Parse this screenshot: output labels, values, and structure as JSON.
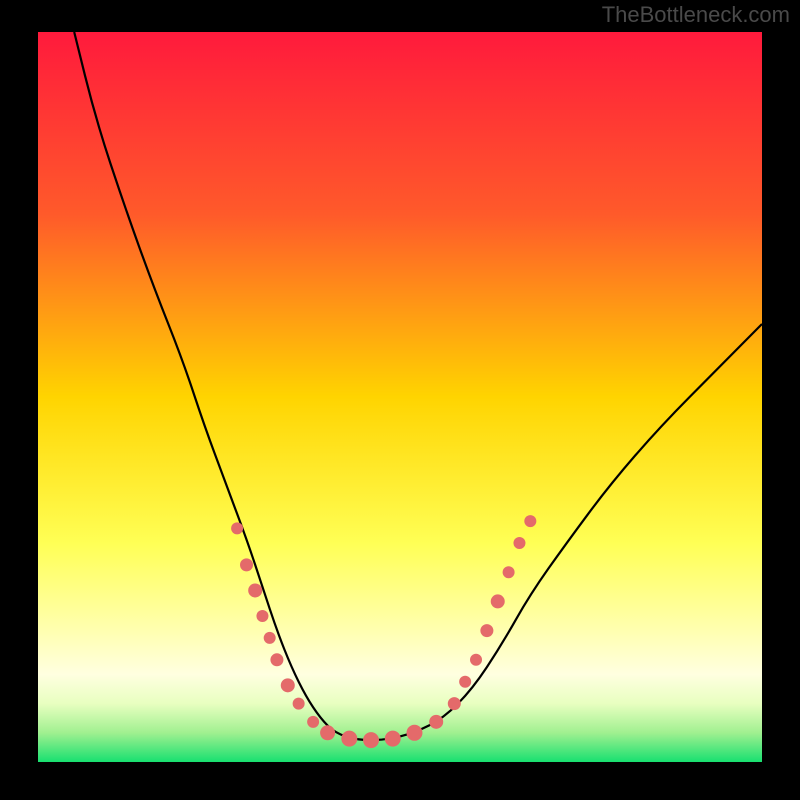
{
  "watermark": "TheBottleneck.com",
  "chart_data": {
    "type": "line",
    "title": "",
    "xlabel": "",
    "ylabel": "",
    "xlim": [
      0,
      100
    ],
    "ylim": [
      0,
      100
    ],
    "gradient_stops": [
      {
        "offset": 0,
        "color": "#ff1a3c"
      },
      {
        "offset": 25,
        "color": "#ff5a2a"
      },
      {
        "offset": 50,
        "color": "#ffd400"
      },
      {
        "offset": 70,
        "color": "#ffff55"
      },
      {
        "offset": 82,
        "color": "#ffffb0"
      },
      {
        "offset": 88,
        "color": "#ffffe0"
      },
      {
        "offset": 92,
        "color": "#e8ffc0"
      },
      {
        "offset": 96,
        "color": "#a0f090"
      },
      {
        "offset": 100,
        "color": "#18e070"
      }
    ],
    "series": [
      {
        "name": "curve",
        "x": [
          5,
          8,
          12,
          16,
          20,
          23,
          26,
          29,
          31,
          33,
          35,
          37,
          39,
          41,
          44,
          48,
          52,
          56,
          60,
          64,
          68,
          73,
          79,
          86,
          94,
          100
        ],
        "y": [
          100,
          88,
          76,
          65,
          55,
          46,
          38,
          30,
          24,
          18,
          13,
          9,
          6,
          4,
          3,
          3,
          4,
          6,
          10,
          16,
          23,
          30,
          38,
          46,
          54,
          60
        ]
      }
    ],
    "scatter": {
      "name": "markers",
      "color": "#e46a6a",
      "points": [
        {
          "x": 27.5,
          "y": 32,
          "r": 6
        },
        {
          "x": 28.8,
          "y": 27,
          "r": 6.5
        },
        {
          "x": 30.0,
          "y": 23.5,
          "r": 7
        },
        {
          "x": 31.0,
          "y": 20,
          "r": 6
        },
        {
          "x": 32.0,
          "y": 17,
          "r": 6
        },
        {
          "x": 33.0,
          "y": 14,
          "r": 6.5
        },
        {
          "x": 34.5,
          "y": 10.5,
          "r": 7
        },
        {
          "x": 36.0,
          "y": 8,
          "r": 6
        },
        {
          "x": 38.0,
          "y": 5.5,
          "r": 6
        },
        {
          "x": 40.0,
          "y": 4,
          "r": 7.5
        },
        {
          "x": 43.0,
          "y": 3.2,
          "r": 8
        },
        {
          "x": 46.0,
          "y": 3.0,
          "r": 8
        },
        {
          "x": 49.0,
          "y": 3.2,
          "r": 8
        },
        {
          "x": 52.0,
          "y": 4.0,
          "r": 8
        },
        {
          "x": 55.0,
          "y": 5.5,
          "r": 7
        },
        {
          "x": 57.5,
          "y": 8,
          "r": 6.5
        },
        {
          "x": 59.0,
          "y": 11,
          "r": 6
        },
        {
          "x": 60.5,
          "y": 14,
          "r": 6
        },
        {
          "x": 62.0,
          "y": 18,
          "r": 6.5
        },
        {
          "x": 63.5,
          "y": 22,
          "r": 7
        },
        {
          "x": 65.0,
          "y": 26,
          "r": 6
        },
        {
          "x": 66.5,
          "y": 30,
          "r": 6
        },
        {
          "x": 68.0,
          "y": 33,
          "r": 6
        }
      ]
    }
  }
}
